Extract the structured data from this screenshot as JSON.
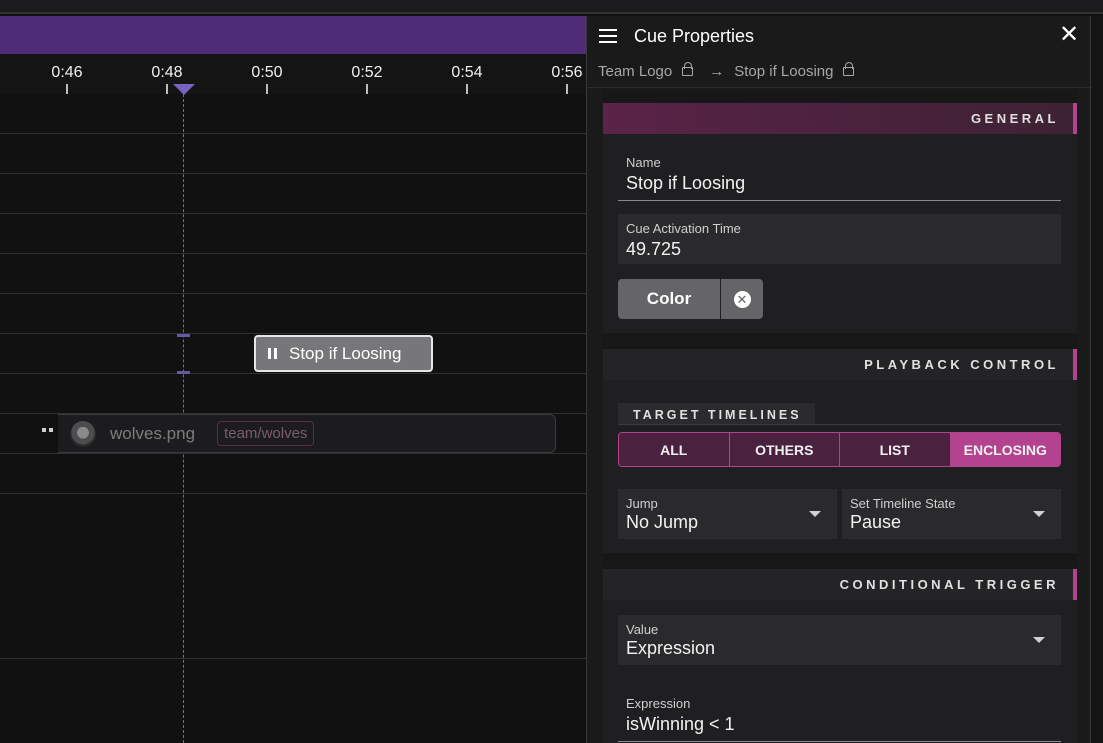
{
  "timeline": {
    "ticks": [
      "0:46",
      "0:48",
      "0:50",
      "0:52",
      "0:54",
      "0:56"
    ],
    "cue_chip_label": "Stop if Loosing",
    "clip": {
      "filename": "wolves.png",
      "tag": "team/wolves"
    }
  },
  "panel": {
    "title": "Cue Properties",
    "breadcrumb": {
      "parent": "Team Logo",
      "current": "Stop if Loosing"
    },
    "general": {
      "heading": "GENERAL",
      "name_label": "Name",
      "name_value": "Stop if Loosing",
      "activation_label": "Cue Activation Time",
      "activation_value": "49.725",
      "color_button": "Color"
    },
    "playback": {
      "heading": "PLAYBACK CONTROL",
      "target_label": "TARGET TIMELINES",
      "targets": [
        "ALL",
        "OTHERS",
        "LIST",
        "ENCLOSING"
      ],
      "active_target": "ENCLOSING",
      "jump_label": "Jump",
      "jump_value": "No Jump",
      "state_label": "Set Timeline State",
      "state_value": "Pause"
    },
    "conditional": {
      "heading": "CONDITIONAL TRIGGER",
      "value_label": "Value",
      "value_value": "Expression",
      "expression_label": "Expression",
      "expression_value": "isWinning < 1"
    }
  },
  "colors": {
    "accent": "#b4438f",
    "header_purple": "#4f2d79",
    "playhead": "#7862c2"
  }
}
